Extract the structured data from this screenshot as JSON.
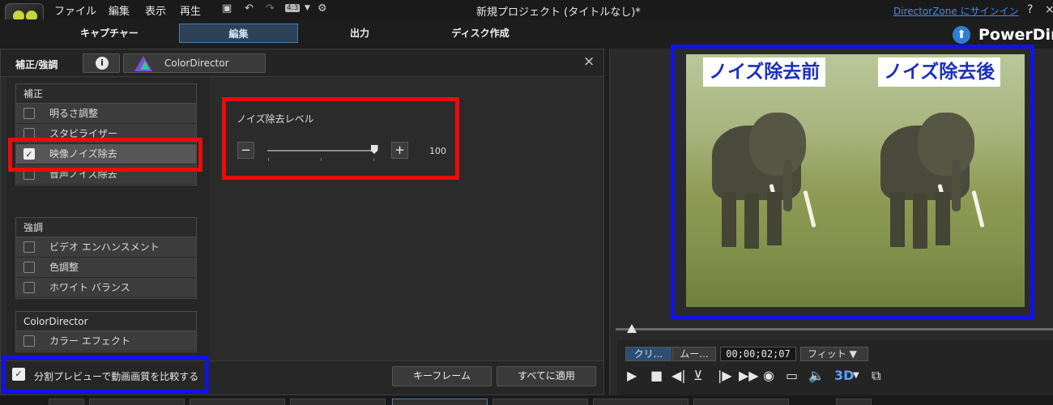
{
  "menubar": {
    "items": [
      "ファイル",
      "編集",
      "表示",
      "再生"
    ],
    "aspect_badge": "4:3",
    "window_title": "新規プロジェクト (タイトルなし)*",
    "signin_link": "DirectorZone にサインイン",
    "help_label": "?",
    "close_label": "×"
  },
  "modes": {
    "capture": "キャプチャー",
    "edit": "編集",
    "output": "出力",
    "disc": "ディスク作成",
    "brand": "PowerDir"
  },
  "panel": {
    "title": "補正/強調",
    "info_icon": "i",
    "colordirector_label": "ColorDirector",
    "close_label": "×"
  },
  "groups": {
    "correction": {
      "header": "補正",
      "items": [
        "明るさ調整",
        "スタビライザー",
        "映像ノイズ除去",
        "音声ノイズ除去"
      ],
      "selected_index": 2
    },
    "enhance": {
      "header": "強調",
      "items": [
        "ビデオ エンハンスメント",
        "色調整",
        "ホワイト バランス"
      ]
    },
    "colordirector": {
      "header": "ColorDirector",
      "items": [
        "カラー エフェクト"
      ]
    }
  },
  "noise": {
    "label": "ノイズ除去レベル",
    "minus_label": "−",
    "plus_label": "+",
    "value": "100",
    "level_fraction": 1.0
  },
  "footer": {
    "compare_label": "分割プレビューで動画画質を比較する",
    "compare_checked": true,
    "keyframe_label": "キーフレーム",
    "apply_all_label": "すべてに適用"
  },
  "preview": {
    "before_label": "ノイズ除去前",
    "after_label": "ノイズ除去後"
  },
  "controls": {
    "clip_label": "クリ...",
    "movie_label": "ムー...",
    "timecode": "00;00;02;07",
    "fit_label": "フィット ▼",
    "mode_3d": "3D"
  },
  "colors": {
    "highlight_red": "#ee0a0a",
    "highlight_blue": "#1212e6",
    "link_blue": "#3f8ee8",
    "label_text_blue": "#1b2fc0"
  }
}
